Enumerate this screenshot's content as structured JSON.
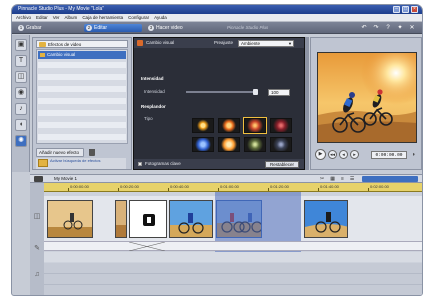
{
  "window": {
    "title": "Pinnacle Studio Plus - My Movie \"Lola\""
  },
  "menu": [
    "Archivo",
    "Editar",
    "Ver",
    "Album",
    "Caja de herramienta",
    "Configurar",
    "Ayuda"
  ],
  "modes": [
    {
      "num": "1",
      "label": "Grabar"
    },
    {
      "num": "2",
      "label": "Editar"
    },
    {
      "num": "3",
      "label": "Hacer video"
    }
  ],
  "brand": "Pinnacle Studio Plus",
  "top_icons": [
    "undo-icon",
    "redo-icon",
    "help-icon",
    "bulb-icon",
    "close-icon"
  ],
  "tools": [
    "film-icon",
    "text-icon",
    "image-icon",
    "disc-icon",
    "music-icon",
    "speaker-icon",
    "effects-icon"
  ],
  "library": {
    "header": "Efectos de video",
    "selected_item": "Cambio visual",
    "add_button": "Añadir nuevo efecto",
    "more_link": "Activar búsqueda de efectos"
  },
  "effect": {
    "name": "Cambio visual",
    "preset_label": "Preajuste",
    "preset_value": "Ambiente",
    "intensity_section": "Intensidad",
    "intensity_label": "Intensidad",
    "intensity_value": "100",
    "intensity_level": 1.0,
    "style_section": "Resplandor",
    "type_label": "Tipo",
    "keyframes_label": "Fotogramas clave",
    "apply_button": "Restablecer",
    "swatches": [
      "#f2a11b",
      "#e86a1c",
      "#c9452a",
      "#8a1f2a",
      "#2f5fd0",
      "#ff9a2e",
      "#5d6c3a",
      "#3b4257"
    ]
  },
  "player": {
    "timecode": "0:00:00.00",
    "buttons": [
      "play-icon",
      "rewind-icon",
      "back-icon",
      "forward-icon",
      "fastforward-icon"
    ]
  },
  "timeline": {
    "movie_name": "My Movie 1",
    "ruler": [
      "0:00:00.00",
      "0:00:20.00",
      "0:00:40.00",
      "0:01:00.00",
      "0:01:20.00",
      "0:01:40.00",
      "0:02:00.00"
    ]
  },
  "colors": {
    "accent": "#3e6fc0",
    "ruler": "#e7d26a",
    "selection": "#506ebe"
  }
}
